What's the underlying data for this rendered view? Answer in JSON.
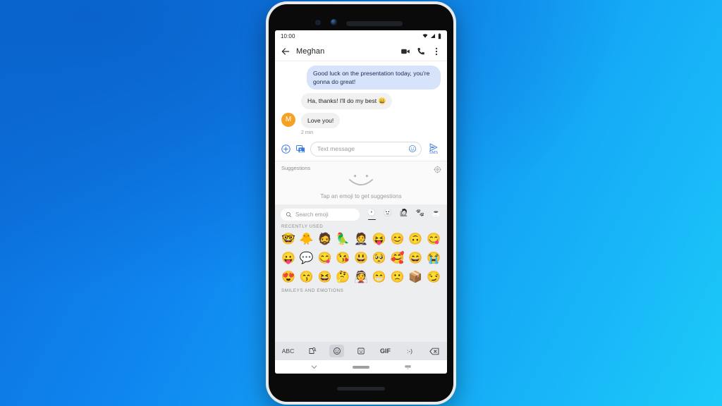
{
  "background": {
    "gradient_from": "#0b6ad6",
    "gradient_to": "#1ccaf9"
  },
  "status_bar": {
    "time": "10:00",
    "icons": [
      "wifi-icon",
      "signal-icon",
      "battery-icon"
    ]
  },
  "conversation_header": {
    "back_icon": "back-arrow-icon",
    "title": "Meghan",
    "actions": [
      "video-call-icon",
      "phone-call-icon",
      "overflow-menu-icon"
    ]
  },
  "thread": {
    "messages": [
      {
        "direction": "outgoing",
        "text": "Good luck on the presentation today, you're gonna do great!",
        "avatar": "",
        "timestamp": ""
      },
      {
        "direction": "incoming",
        "text": "Ha, thanks! I'll do my best 😀",
        "avatar": "",
        "timestamp": ""
      },
      {
        "direction": "incoming",
        "text": "Love you!",
        "avatar": "M",
        "timestamp": "2 min"
      }
    ],
    "avatar_color": "#f4a226",
    "outgoing_bubble_color": "#d7e3fa",
    "incoming_bubble_color": "#f1f1f1"
  },
  "compose": {
    "add_icon": "plus-circle-icon",
    "gallery_icon": "image-gallery-icon",
    "placeholder": "Text message",
    "emoji_icon": "emoji-face-icon",
    "send_icon": "send-arrow-icon",
    "send_label": "SMS",
    "accent_color": "#3d7bd6"
  },
  "suggestions": {
    "label": "Suggestions",
    "settings_icon": "gear-icon",
    "illustration": "smiley-outline-icon",
    "hint": "Tap an emoji to get suggestions"
  },
  "emoji_panel": {
    "search_icon": "search-icon",
    "search_placeholder": "Search emoji",
    "categories": [
      {
        "name": "recent-tab",
        "glyph": "🕐",
        "active": true
      },
      {
        "name": "smileys-tab",
        "glyph": "🙂",
        "active": false
      },
      {
        "name": "people-tab",
        "glyph": "🙋",
        "active": false
      },
      {
        "name": "animals-tab",
        "glyph": "🐾",
        "active": false
      },
      {
        "name": "food-tab",
        "glyph": "☕",
        "active": false
      }
    ],
    "sections": [
      {
        "label": "Recently used",
        "rows": [
          [
            "🤓",
            "🐥",
            "🧔",
            "🦜",
            "🤵",
            "😝",
            "😊",
            "🙃",
            "😋"
          ],
          [
            "😛",
            "💬",
            "😋",
            "😘",
            "😃",
            "🥺",
            "🥰",
            "😄",
            "😭"
          ],
          [
            "😍",
            "😙",
            "😆",
            "🤔",
            "👰",
            "😁",
            "🙁",
            "📦",
            "😏"
          ]
        ]
      },
      {
        "label": "Smileys and emotions",
        "rows": []
      }
    ]
  },
  "keyboard_bar": {
    "buttons": [
      {
        "name": "abc-key",
        "label": "ABC",
        "selected": false
      },
      {
        "name": "sticker-search-key",
        "label": "",
        "selected": false
      },
      {
        "name": "emoji-key",
        "label": "",
        "selected": true
      },
      {
        "name": "sticker-key",
        "label": "",
        "selected": false
      },
      {
        "name": "gif-key",
        "label": "GIF",
        "selected": false
      },
      {
        "name": "kaomoji-key",
        "label": ":-)",
        "selected": false
      },
      {
        "name": "backspace-key",
        "label": "",
        "selected": false
      }
    ]
  },
  "nav_bar": {
    "back_icon": "dismiss-keyboard-chevron-icon",
    "home_indicator": "home-pill",
    "keyboard_switch_icon": "keyboard-switch-icon"
  }
}
